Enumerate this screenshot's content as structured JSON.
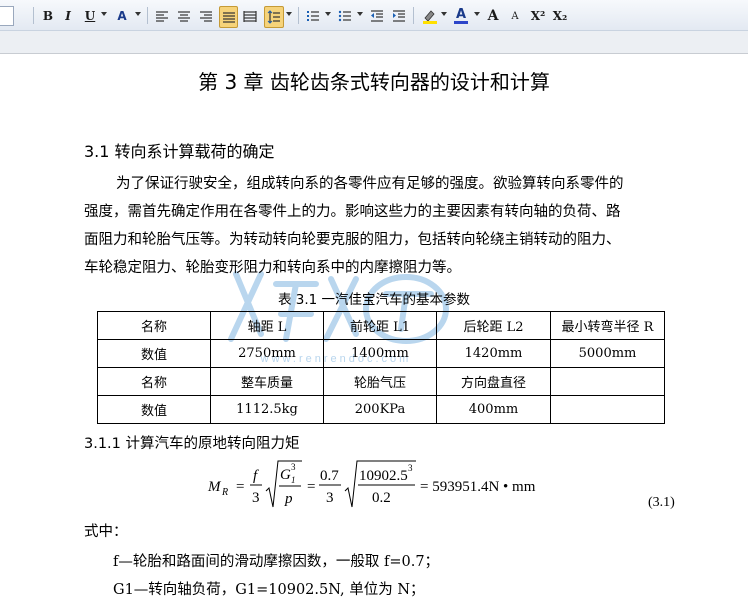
{
  "toolbar": {
    "bold": "B",
    "italic": "I",
    "underline": "U",
    "font_color_a": "A",
    "grow_font": "A",
    "shrink_font": "A",
    "superscript": "X²",
    "subscript": "X₂"
  },
  "document": {
    "title": "第 3 章  齿轮齿条式转向器的设计和计算",
    "section": "3.1 转向系计算载荷的确定",
    "paragraph_lines": [
      "为了保证行驶安全，组成转向系的各零件应有足够的强度。欲验算转向系零件的",
      "强度，需首先确定作用在各零件上的力。影响这些力的主要因素有转向轴的负荷、路",
      "面阻力和轮胎气压等。为转动转向轮要克服的阻力，包括转向轮绕主销转动的阻力、",
      "车轮稳定阻力、轮胎变形阻力和转向系中的内摩擦阻力等。"
    ],
    "table_caption": "表 3.1 一汽佳宝汽车的基本参数",
    "table": {
      "row1": [
        "名称",
        "轴距 L",
        "前轮距 L1",
        "后轮距 L2",
        "最小转弯半径 R"
      ],
      "row2": [
        "数值",
        "2750mm",
        "1400mm",
        "1420mm",
        "5000mm"
      ],
      "row3": [
        "名称",
        "整车质量",
        "轮胎气压",
        "方向盘直径",
        ""
      ],
      "row4": [
        "数值",
        "1112.5kg",
        "200KPa",
        "400mm",
        ""
      ]
    },
    "subsection": "3.1.1 计算汽车的原地转向阻力矩",
    "formula": {
      "lhs": "M",
      "lhs_sub": "R",
      "f": "f",
      "three": "3",
      "g": "G",
      "g_sub": "1",
      "g_sup": "3",
      "p": "p",
      "num": "0.7",
      "big": "10902.5",
      "big_sup": "3",
      "den": "0.2",
      "result": "= 593951.4N • mm",
      "eq_number": "(3.1)"
    },
    "where": "式中：",
    "def1": "f—轮胎和路面间的滑动摩擦因数，一般取 f=0.7；",
    "def2": "G1—转向轴负荷，G1=10902.5N, 单位为 N；"
  },
  "watermark": {
    "url": "www.renrendoc.com"
  }
}
